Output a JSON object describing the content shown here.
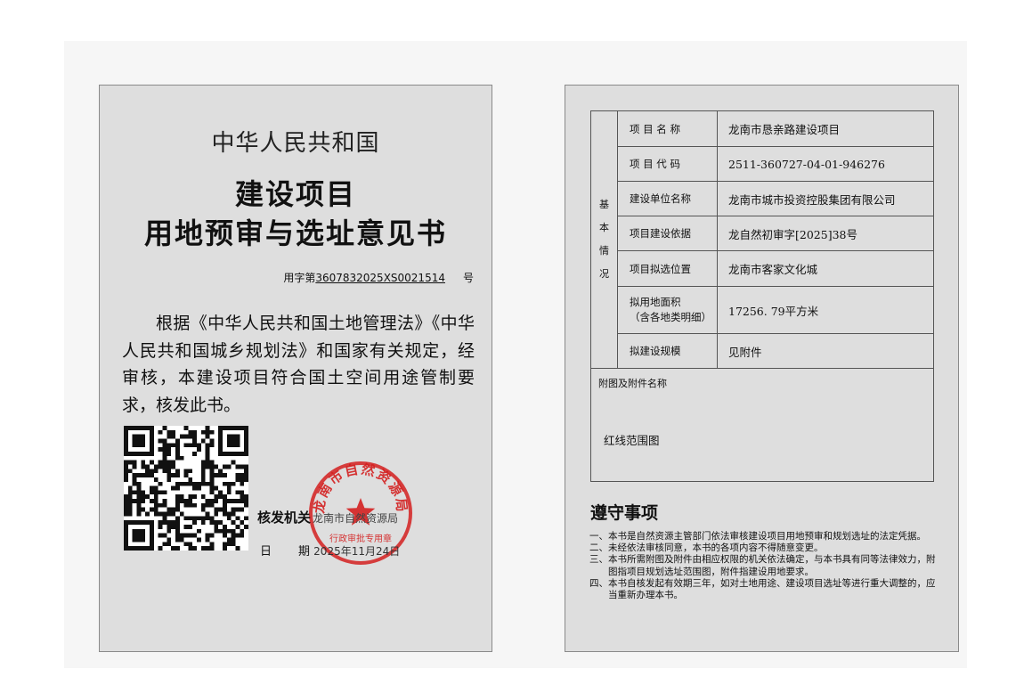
{
  "certificate": {
    "country": "中华人民共和国",
    "title_line1": "建设项目",
    "title_line2": "用地预审与选址意见书",
    "serial_prefix": "用字第",
    "serial_number": "3607832025XS0021514",
    "serial_suffix": "号",
    "body": "根据《中华人民共和国土地管理法》《中华人民共和国城乡规划法》和国家有关规定，经审核，本建设项目符合国土空间用途管制要求，核发此书。",
    "issuer_label": "核发机关",
    "issuer_name": "龙南市自然资源局",
    "date_label_1": "日",
    "date_label_2": "期",
    "date_value": "2025年11月24日",
    "seal": {
      "arc_text": "龙南市自然资源局",
      "bottom_text": "行政审批专用章",
      "color": "#d42020"
    },
    "qr_icon": "qr-code-icon"
  },
  "info": {
    "side_label": [
      "基",
      "本",
      "情",
      "况"
    ],
    "rows": [
      {
        "label": "项 目 名 称",
        "value": "龙南市恳亲路建设项目"
      },
      {
        "label": "项 目 代 码",
        "value": "2511-360727-04-01-946276"
      },
      {
        "label": "建设单位名称",
        "value": "龙南市城市投资控股集团有限公司"
      },
      {
        "label": "项目建设依据",
        "value": "龙自然初审字[2025]38号"
      },
      {
        "label": "项目拟选位置",
        "value": "龙南市客家文化城"
      },
      {
        "label": "拟用地面积\n（含各地类明细）",
        "value": "17256. 79平方米"
      },
      {
        "label": "拟建设规模",
        "value": "见附件"
      }
    ],
    "attachments_label": "附图及附件名称",
    "attachments_item": "红线范围图"
  },
  "notice": {
    "title": "遵守事项",
    "items": [
      {
        "num": "一、",
        "text": "本书是自然资源主管部门依法审核建设项目用地预审和规划选址的法定凭据。"
      },
      {
        "num": "二、",
        "text": "未经依法审核同意，本书的各项内容不得随意变更。"
      },
      {
        "num": "三、",
        "text": "本书所需附图及附件由相应权限的机关依法确定，与本书具有同等法律效力，附图指项目规划选址范围图，附件指建设用地要求。"
      },
      {
        "num": "四、",
        "text": "本书自核发起有效期三年，如对土地用途、建设项目选址等进行重大调整的，应当重新办理本书。"
      }
    ]
  }
}
